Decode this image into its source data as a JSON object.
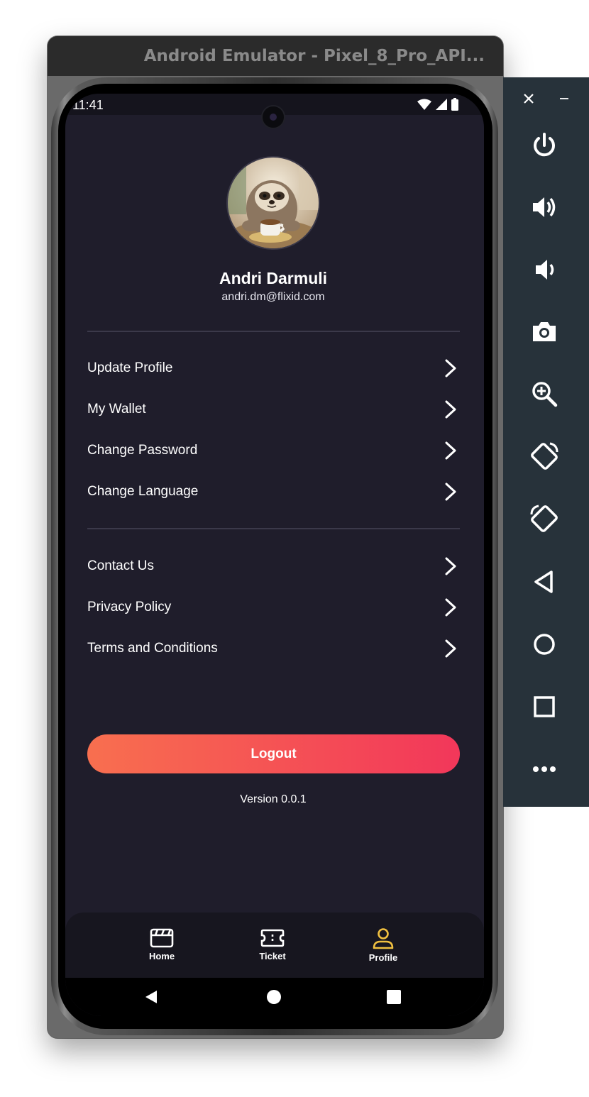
{
  "emulator": {
    "window_title": "Android Emulator - Pixel_8_Pro_API...",
    "toolbar": [
      "close-icon",
      "minimize-icon",
      "power-icon",
      "volume-up-icon",
      "volume-down-icon",
      "camera-icon",
      "zoom-icon",
      "rotate-left-icon",
      "rotate-right-icon",
      "back-icon",
      "home-icon",
      "overview-icon",
      "more-icon"
    ]
  },
  "status_bar": {
    "time": "11:41"
  },
  "profile": {
    "name": "Andri Darmuli",
    "email": "andri.dm@flixid.com"
  },
  "menu_primary": [
    {
      "label": "Update Profile"
    },
    {
      "label": "My Wallet"
    },
    {
      "label": "Change Password"
    },
    {
      "label": "Change Language"
    }
  ],
  "menu_secondary": [
    {
      "label": "Contact Us"
    },
    {
      "label": "Privacy Policy"
    },
    {
      "label": "Terms and Conditions"
    }
  ],
  "logout_label": "Logout",
  "version": "Version 0.0.1",
  "bottom_nav": [
    {
      "label": "Home",
      "icon": "clapperboard-icon",
      "active": false
    },
    {
      "label": "Ticket",
      "icon": "ticket-icon",
      "active": false
    },
    {
      "label": "Profile",
      "icon": "person-icon",
      "active": true
    }
  ],
  "colors": {
    "background": "#1f1d2b",
    "logout_gradient_start": "#f86f4f",
    "logout_gradient_end": "#f2375a",
    "active_nav": "#f0c040"
  }
}
